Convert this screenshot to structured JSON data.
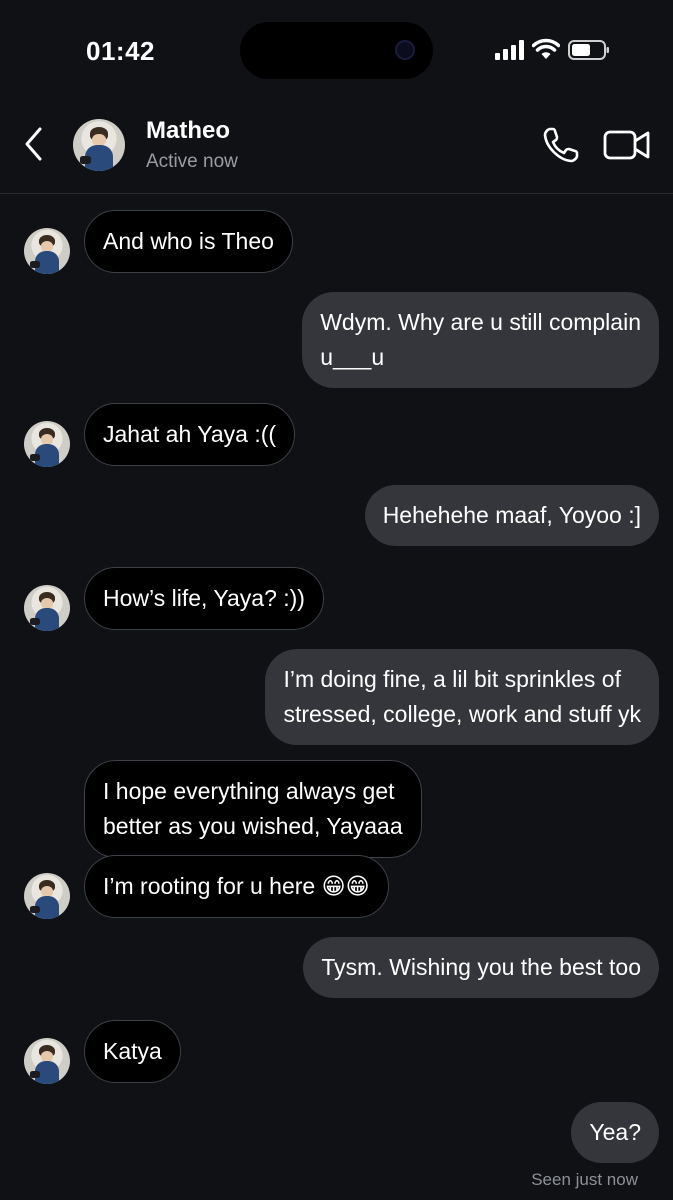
{
  "status_bar": {
    "time": "01:42"
  },
  "header": {
    "contact_name": "Matheo",
    "contact_status": "Active now",
    "icons": [
      "back-chevron-icon",
      "phone-icon",
      "video-camera-icon"
    ]
  },
  "messages": [
    {
      "from": "them",
      "text": "And who is Theo"
    },
    {
      "from": "me",
      "lines": [
        "Wdym. Why are u still complain",
        "u___u"
      ]
    },
    {
      "from": "them",
      "text": "Jahat ah Yaya :(("
    },
    {
      "from": "me",
      "text": "Hehehehe maaf, Yoyoo :]"
    },
    {
      "from": "them",
      "text": "How’s life, Yaya? :))"
    },
    {
      "from": "me",
      "lines": [
        "I’m doing fine, a lil bit sprinkles of",
        "stressed, college, work and stuff yk"
      ]
    },
    {
      "from": "them",
      "lines": [
        "I hope everything always get",
        "better as you wished, Yayaaa"
      ]
    },
    {
      "from": "them",
      "text": "I’m rooting for u here 😁😁"
    },
    {
      "from": "me",
      "text": "Tysm. Wishing you the best too"
    },
    {
      "from": "them",
      "text": "Katya"
    },
    {
      "from": "me",
      "text": "Yea?"
    }
  ],
  "seen_status": "Seen just now"
}
